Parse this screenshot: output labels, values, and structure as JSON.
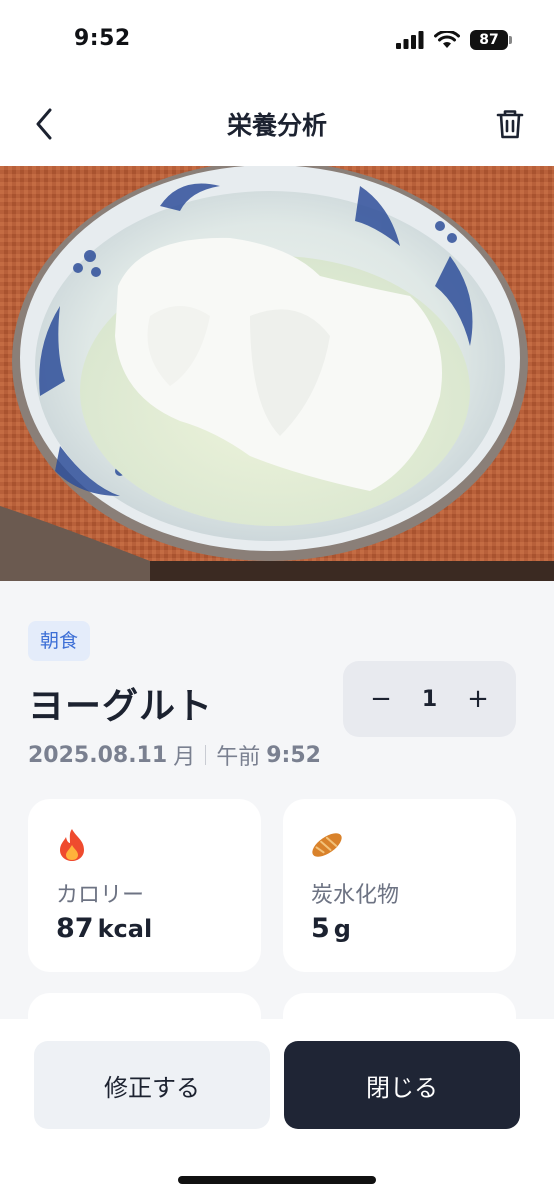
{
  "status_bar": {
    "time": "9:52",
    "battery": "87",
    "icons": [
      "cellular-signal-icon",
      "wifi-icon",
      "battery-icon"
    ]
  },
  "nav": {
    "title": "栄養分析",
    "back_icon": "chevron-left-icon",
    "delete_icon": "trash-icon"
  },
  "photo": {
    "subject": "yogurt-in-blue-white-bowl"
  },
  "food": {
    "meal_badge": "朝食",
    "name": "ヨーグルト",
    "quantity": "1",
    "minus": "−",
    "plus": "+",
    "date": "2025.08.11",
    "weekday": "月",
    "period": "午前",
    "time": "9:52"
  },
  "nutrients": [
    {
      "icon": "fire-icon",
      "label": "カロリー",
      "value": "87",
      "unit": "kcal"
    },
    {
      "icon": "bread-icon",
      "label": "炭水化物",
      "value": "5",
      "unit": "g"
    }
  ],
  "actions": {
    "edit_label": "修正する",
    "close_label": "閉じる"
  },
  "colors": {
    "accent_dark": "#1f2535",
    "badge_blue": "#3d6fd6",
    "background_gray": "#f5f6f8"
  }
}
